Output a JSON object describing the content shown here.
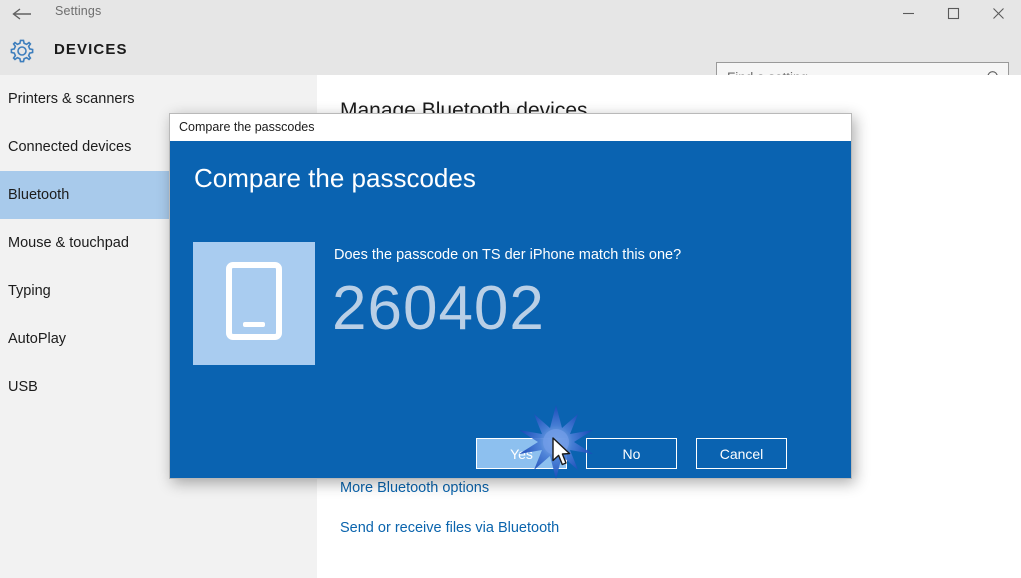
{
  "window": {
    "title": "Settings",
    "back_icon": "back-arrow-icon",
    "minimize_icon": "minimize-icon",
    "maximize_icon": "maximize-icon",
    "close_icon": "close-icon"
  },
  "header": {
    "icon": "gear-icon",
    "title": "DEVICES"
  },
  "search": {
    "value": "",
    "placeholder": "Find a setting",
    "icon": "search-icon"
  },
  "sidebar": {
    "items": [
      {
        "label": "Printers & scanners",
        "selected": false
      },
      {
        "label": "Connected devices",
        "selected": false
      },
      {
        "label": "Bluetooth",
        "selected": true
      },
      {
        "label": "Mouse & touchpad",
        "selected": false
      },
      {
        "label": "Typing",
        "selected": false
      },
      {
        "label": "AutoPlay",
        "selected": false
      },
      {
        "label": "USB",
        "selected": false
      }
    ]
  },
  "main": {
    "heading": "Manage Bluetooth devices",
    "links": [
      {
        "label": "More Bluetooth options"
      },
      {
        "label": "Send or receive files via Bluetooth"
      }
    ]
  },
  "dialog": {
    "titlebar_text": "Compare the passcodes",
    "heading": "Compare the passcodes",
    "question": "Does the passcode on TS der iPhone match this one?",
    "passcode": "260402",
    "device_icon": "phone-icon",
    "buttons": [
      {
        "label": "Yes",
        "primary": true
      },
      {
        "label": "No",
        "primary": false
      },
      {
        "label": "Cancel",
        "primary": false
      }
    ]
  },
  "colors": {
    "dialog_blue": "#0a63b1",
    "accent_link": "#0a64ad",
    "selection": "#a8caeb",
    "passcode_text": "#b9cfe6",
    "primary_button": "#8dc0ef"
  },
  "pointer": {
    "cursor_icon": "mouse-cursor-icon",
    "click_effect_icon": "click-burst-icon"
  }
}
